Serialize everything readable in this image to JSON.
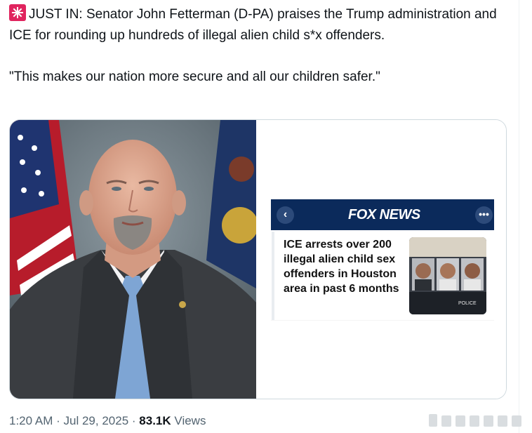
{
  "tweet": {
    "line1": "JUST IN: Senator John Fetterman (D-PA) praises the Trump administration and ICE for rounding up hundreds of illegal alien child s*x offenders.",
    "quote": "\"This makes our nation more secure and all our children safer.\""
  },
  "card": {
    "logo": "FOX NEWS",
    "headline": "ICE arrests over 200 illegal alien child sex offenders in Houston area in past 6 months",
    "back_glyph": "‹",
    "more_glyph": "•••",
    "police_label": "POLICE"
  },
  "meta": {
    "time": "1:20 AM",
    "date": "Jul 29, 2025",
    "sep": "·",
    "views_count": "83.1K",
    "views_label": "Views"
  },
  "colors": {
    "fox_header": "#0b2a5b",
    "siren": "#e0245e",
    "text": "#0f1419",
    "secondary": "#536471"
  },
  "icons": [
    "siren-emoji-icon",
    "chevron-left-icon",
    "more-icon"
  ]
}
